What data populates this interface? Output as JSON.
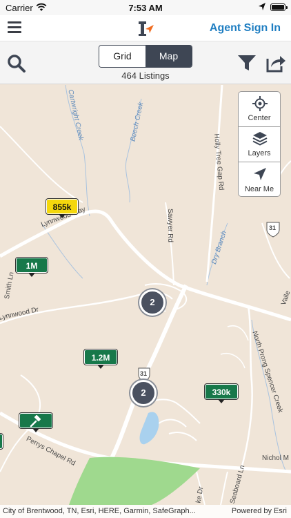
{
  "status_bar": {
    "carrier": "Carrier",
    "time": "7:53 AM"
  },
  "nav": {
    "menu_icon": "hamburger-icon",
    "logo_icon": "brand-logo-icon",
    "agent_sign_in": "Agent Sign In",
    "accent_color": "#1f7ec2"
  },
  "toolbar": {
    "tabs": [
      {
        "label": "Grid",
        "selected": false
      },
      {
        "label": "Map",
        "selected": true
      }
    ],
    "listings_count": "464 Listings"
  },
  "map_controls": [
    {
      "label": "Center",
      "icon": "crosshair-icon"
    },
    {
      "label": "Layers",
      "icon": "layers-icon"
    },
    {
      "label": "Near Me",
      "icon": "navigation-arrow-icon"
    }
  ],
  "map": {
    "road_labels": [
      "Lynnwood Way",
      "Sawyer Rd",
      "Holly Tree Gap Rd",
      "Smith Ln",
      "Lynnwood Dr",
      "North Prong Spencer Creek",
      "Perrys Chapel Rd",
      "Nichol M",
      "Seaboard Ln",
      "Valle",
      "ke Dr"
    ],
    "water_labels": [
      "Cartwright Creek",
      "Beech Creek",
      "Dry Branch"
    ],
    "highway_shields": [
      "31",
      "31"
    ],
    "price_markers": [
      {
        "label": "855k",
        "color": "yellow"
      },
      {
        "label": "1M",
        "color": "green"
      },
      {
        "label": "1.2M",
        "color": "green"
      },
      {
        "label": "330k",
        "color": "green"
      }
    ],
    "auction_marker_icon": "gavel-icon",
    "clusters": [
      "2",
      "2"
    ]
  },
  "attribution": {
    "left": "City of Brentwood, TN, Esri, HERE, Garmin, SafeGraph...",
    "right": "Powered by Esri"
  }
}
